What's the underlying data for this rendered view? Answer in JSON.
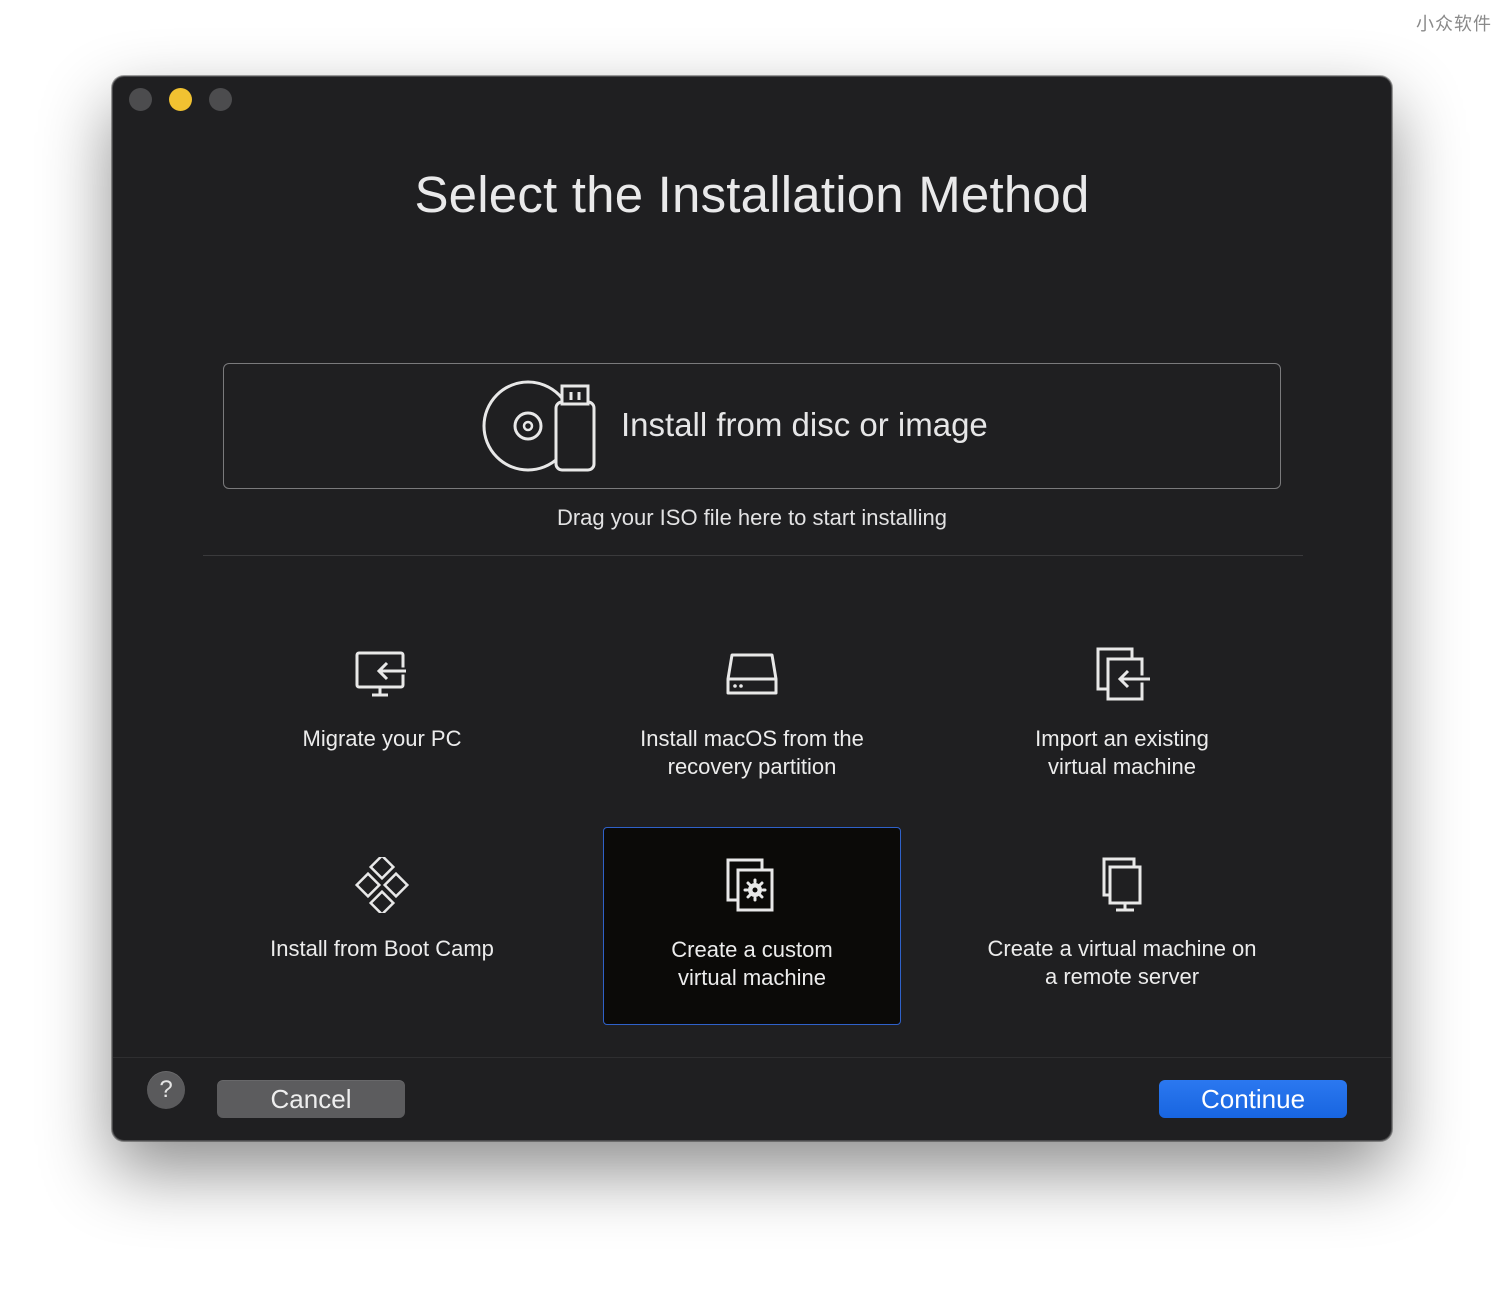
{
  "watermark": "小众软件",
  "window": {
    "title": "Select the Installation Method"
  },
  "disc": {
    "label": "Install from disc or image",
    "hint": "Drag your ISO file here to start installing"
  },
  "options": [
    {
      "label": "Migrate your PC",
      "icon": "monitor-import-icon"
    },
    {
      "label": "Install macOS from the recovery partition",
      "icon": "hard-drive-icon"
    },
    {
      "label": "Import an existing virtual machine",
      "icon": "vm-import-icon"
    },
    {
      "label": "Install from Boot Camp",
      "icon": "bootcamp-diamond-icon"
    },
    {
      "label": "Create a custom virtual machine",
      "icon": "vm-gear-icon",
      "selected": true
    },
    {
      "label": "Create a virtual machine on a remote server",
      "icon": "remote-server-icon"
    }
  ],
  "footer": {
    "help": "?",
    "cancel": "Cancel",
    "continue": "Continue"
  },
  "colors": {
    "window_bg": "#1f1f21",
    "selected_border": "#2f61c9",
    "continue_blue": "#1f6feb",
    "minimize_yellow": "#f1c231"
  }
}
